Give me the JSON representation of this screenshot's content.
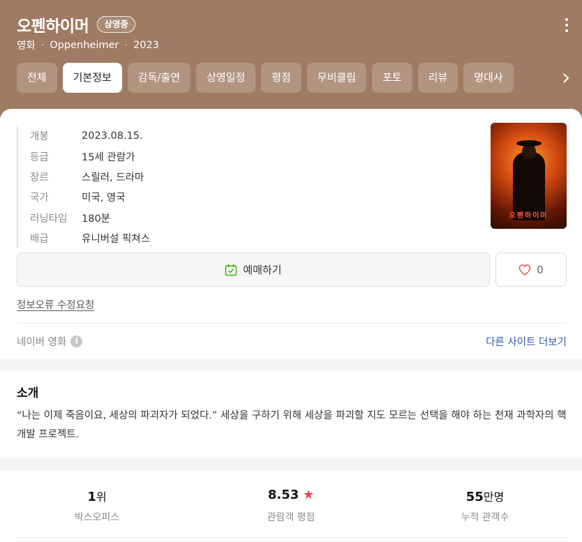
{
  "header": {
    "title": "오펜하이머",
    "badge": "상영중",
    "genre_label": "영화",
    "original_title": "Oppenheimer",
    "year": "2023",
    "dot": "·"
  },
  "tabs": [
    {
      "label": "전체",
      "active": false
    },
    {
      "label": "기본정보",
      "active": true
    },
    {
      "label": "감독/출연",
      "active": false
    },
    {
      "label": "상영일정",
      "active": false
    },
    {
      "label": "평점",
      "active": false
    },
    {
      "label": "무비클립",
      "active": false
    },
    {
      "label": "포토",
      "active": false
    },
    {
      "label": "리뷰",
      "active": false
    },
    {
      "label": "명대사",
      "active": false
    }
  ],
  "info": [
    {
      "key": "개봉",
      "value": "2023.08.15."
    },
    {
      "key": "등급",
      "value": "15세 관람가"
    },
    {
      "key": "장르",
      "value": "스릴러, 드라마"
    },
    {
      "key": "국가",
      "value": "미국, 영국"
    },
    {
      "key": "러닝타임",
      "value": "180분"
    },
    {
      "key": "배급",
      "value": "유니버설 픽쳐스"
    }
  ],
  "poster": {
    "title": "오펜하이머"
  },
  "actions": {
    "reserve_label": "예매하기",
    "like_count": "0"
  },
  "report_link": "정보오류 수정요청",
  "source": {
    "label": "네이버 영화",
    "info_glyph": "i",
    "other_sites": "다른 사이트 더보기"
  },
  "intro": {
    "title": "소개",
    "text": "“나는 이제 죽음이요, 세상의 파괴자가 되었다.” 세상을 구하기 위해 세상을 파괴할 지도 모르는 선택을 해야 하는 천재 과학자의 핵개발 프로젝트."
  },
  "stats": {
    "box_office": {
      "value": "1",
      "unit": "위",
      "label": "박스오피스"
    },
    "rating": {
      "value": "8.53",
      "star": "★",
      "label": "관람객 평점"
    },
    "audience": {
      "value": "55",
      "unit": "만명",
      "label": "누적 관객수"
    }
  },
  "colors": {
    "header_bg": "#9e7b62",
    "link": "#2f5aa8",
    "star": "#f04452",
    "reserve_icon": "#2db400"
  }
}
